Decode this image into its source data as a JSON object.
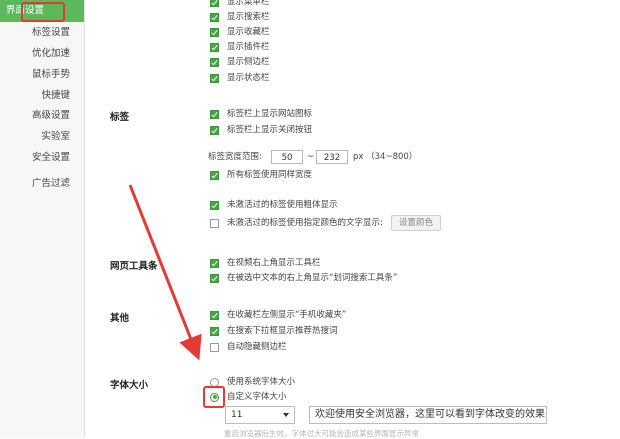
{
  "sidebar": {
    "items": [
      {
        "label": "界面设置",
        "active": true
      },
      {
        "label": "标签设置"
      },
      {
        "label": "优化加速"
      },
      {
        "label": "鼠标手势"
      },
      {
        "label": "快捷键"
      },
      {
        "label": "高级设置"
      },
      {
        "label": "实验室"
      },
      {
        "label": "安全设置"
      },
      {
        "label": "广告过滤"
      }
    ]
  },
  "toolbars": {
    "items": [
      {
        "label": "显示菜单栏",
        "checked": true
      },
      {
        "label": "显示搜索栏",
        "checked": true
      },
      {
        "label": "显示收藏栏",
        "checked": true
      },
      {
        "label": "显示插件栏",
        "checked": true
      },
      {
        "label": "显示侧边栏",
        "checked": true
      },
      {
        "label": "显示状态栏",
        "checked": true
      }
    ]
  },
  "tabs": {
    "title": "标签",
    "show_favicon": "标签栏上显示网站图标",
    "show_close": "标签栏上显示关闭按钮",
    "width_label": "标签宽度范围:",
    "width_min": "50",
    "width_sep": "~",
    "width_max": "232",
    "width_unit": "px （34~800）",
    "same_width": "所有标签使用同样宽度",
    "bold_inactive": "未激活过的标签使用粗体显示",
    "color_inactive": "未激活过的标签使用指定颜色的文字显示:",
    "set_color": "设置颜色"
  },
  "web_tools": {
    "title": "网页工具条",
    "video_toolbar": "在视频右上角显示工具栏",
    "selection_toolbar": "在被选中文本的右上角显示“划词搜索工具条”"
  },
  "other": {
    "title": "其他",
    "phone_fav": "在收藏栏左侧显示“手机收藏夹”",
    "hot_search": "在搜索下拉框显示推荐热搜词",
    "auto_hide": "自动隐藏侧边栏"
  },
  "font": {
    "title": "字体大小",
    "system": "使用系统字体大小",
    "custom": "自定义字体大小",
    "size": "11",
    "preview": "欢迎使用安全浏览器，这里可以看到字体改变的效果",
    "note": "重启浏览器后生效。字体过大可能会造成某些界面显示异常"
  },
  "colors": {
    "accent": "#5cb85c",
    "checkbox": "#41a83e",
    "annotation": "#e53935"
  }
}
